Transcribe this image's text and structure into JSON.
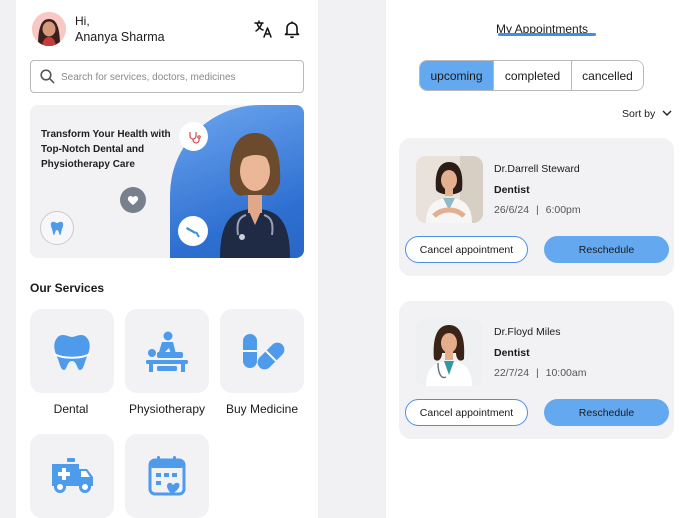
{
  "home": {
    "greeting": "Hi,",
    "user_name": "Ananya Sharma",
    "search_placeholder": "Search for services, doctors, medicines",
    "banner_text": "Transform Your Health with Top-Notch Dental and Physiotherapy Care",
    "section_title": "Our Services",
    "services": [
      {
        "label": "Dental",
        "icon": "tooth-icon"
      },
      {
        "label": "Physiotherapy",
        "icon": "physiotherapy-icon"
      },
      {
        "label": "Buy Medicine",
        "icon": "pill-icon"
      },
      {
        "label": "",
        "icon": "ambulance-icon"
      },
      {
        "label": "",
        "icon": "calendar-icon"
      }
    ],
    "accent_color": "#2d6fd1",
    "icon_color": "#4e9aeb"
  },
  "appointments": {
    "title": "My Appointments",
    "tabs": [
      "upcoming",
      "completed",
      "cancelled"
    ],
    "active_tab": "upcoming",
    "sort_label": "Sort by",
    "cards": [
      {
        "doctor": "Dr.Darrell Steward",
        "specialty": "Dentist",
        "date": "26/6/24",
        "time": "6:00pm",
        "cancel_label": "Cancel appointment",
        "reschedule_label": "Reschedule"
      },
      {
        "doctor": "Dr.Floyd Miles",
        "specialty": "Dentist",
        "date": "22/7/24",
        "time": "10:00am",
        "cancel_label": "Cancel appointment",
        "reschedule_label": "Reschedule"
      }
    ]
  }
}
